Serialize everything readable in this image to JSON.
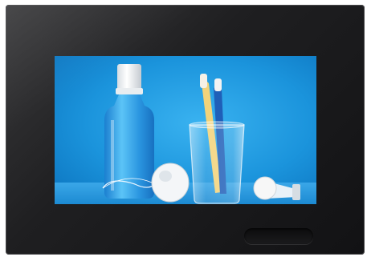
{
  "device": {
    "frame_color": "#1f1f21",
    "screen_image": {
      "subject": "dental-care-products",
      "background_color": "#1b94dc",
      "items": [
        "mouthwash-bottle",
        "dental-floss",
        "toothbrushes-in-glass",
        "toothpaste-tube"
      ]
    },
    "home_button": {
      "shape": "pill",
      "color": "#111112"
    }
  }
}
